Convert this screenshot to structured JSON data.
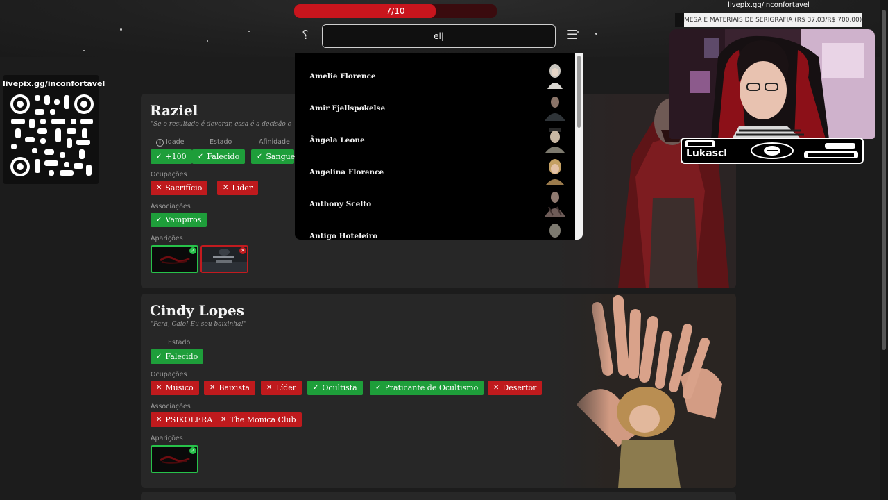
{
  "progress": {
    "text": "7/10",
    "value": 0.7,
    "color": "#c8151d"
  },
  "search": {
    "value": "el|"
  },
  "icons": {
    "hint": "question-hint-icon",
    "menu": "hamburger-menu-icon"
  },
  "qr_panel": {
    "title": "livepix.gg/inconfortavel"
  },
  "stream_overlay": {
    "link": "livepix.gg/inconfortavel",
    "goal_banner": "MESA E MATERIAIS DE SERIGRAFIA (R$ 37,03/R$ 700,00)",
    "streamer_name": "Lukascl"
  },
  "cards": [
    {
      "name": "Raziel",
      "quote": "\"Se o resultado é devorar, essa é a decisão c",
      "attribute_labels": {
        "age": "Idade",
        "state": "Estado",
        "affinity": "Afinidade"
      },
      "attributes": {
        "age": "+100",
        "state": "Falecido",
        "affinity": "Sangue"
      },
      "occupations_label": "Ocupações",
      "occupations": [
        {
          "label": "Sacrifício",
          "status": "no"
        },
        {
          "label": "Líder",
          "status": "no"
        }
      ],
      "associations_label": "Associações",
      "associations": [
        {
          "label": "Vampiros",
          "status": "ok"
        }
      ],
      "appearances_label": "Aparições",
      "appearances": [
        {
          "status": "ok"
        },
        {
          "status": "no"
        }
      ]
    },
    {
      "name": "Cindy Lopes",
      "quote": "\"Para, Caio! Eu sou baixinha!\"",
      "attribute_labels": {
        "state": "Estado"
      },
      "attributes": {
        "state": "Falecido"
      },
      "occupations_label": "Ocupações",
      "occupations": [
        {
          "label": "Músico",
          "status": "no"
        },
        {
          "label": "Baixista",
          "status": "no"
        },
        {
          "label": "Líder",
          "status": "no"
        },
        {
          "label": "Ocultista",
          "status": "ok"
        },
        {
          "label": "Praticante de Ocultismo",
          "status": "ok"
        },
        {
          "label": "Desertor",
          "status": "no"
        }
      ],
      "associations_label": "Associações",
      "associations": [
        {
          "label": "PSIKOLERA",
          "status": "no"
        },
        {
          "label": "The Monica Club",
          "status": "no"
        }
      ],
      "appearances_label": "Aparições",
      "appearances": [
        {
          "status": "ok"
        }
      ]
    }
  ],
  "dropdown": {
    "items": [
      {
        "name": "Amelie Florence"
      },
      {
        "name": "Amir Fjellspøkelse"
      },
      {
        "name": "Ângela Leone"
      },
      {
        "name": "Angelina Florence"
      },
      {
        "name": "Anthony Scelto"
      },
      {
        "name": "Antigo Hoteleiro"
      }
    ]
  },
  "colors": {
    "ok": "#1e9e3a",
    "no": "#bf1a1d",
    "accent": "#c8151d",
    "card": "#272727"
  }
}
